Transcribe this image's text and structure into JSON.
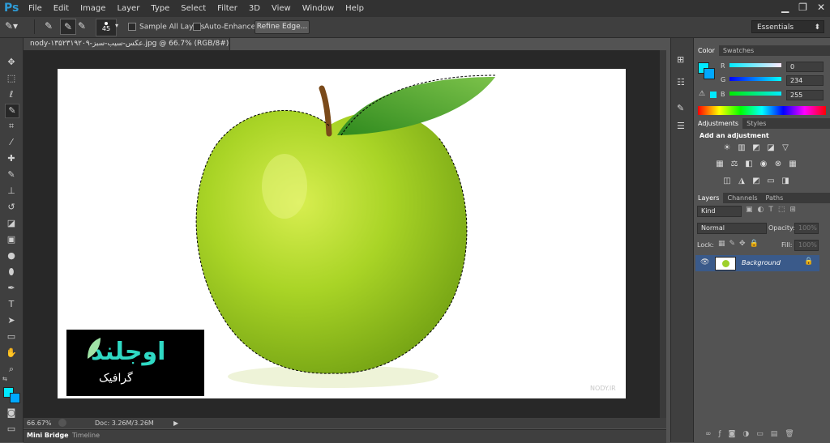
{
  "app": {
    "logo": "Ps"
  },
  "menu": [
    "File",
    "Edit",
    "Image",
    "Layer",
    "Type",
    "Select",
    "Filter",
    "3D",
    "View",
    "Window",
    "Help"
  ],
  "window_controls": [
    "minimize-icon",
    "restore-icon",
    "close-icon"
  ],
  "options": {
    "brush_size": "45",
    "sample_all_layers": "Sample All Layers",
    "auto_enhance": "Auto-Enhance",
    "refine_edge": "Refine Edge...",
    "workspace": "Essentials"
  },
  "document": {
    "tab_title": "nody-۱۳۵۲۳۱۹۲۰۹-عکس-سیب-سبز.jpg @ 66.7% (RGB/8#)",
    "tab_close": "×",
    "zoom": "66.67%",
    "doc_info": "Doc: 3.26M/3.26M",
    "watermark": "NODY.IR"
  },
  "logo_overlay": {
    "brand": "اوجلند",
    "subtitle": "گرافیک"
  },
  "bottom_tabs": [
    "Mini Bridge",
    "Timeline"
  ],
  "color_panel": {
    "tabs": [
      "Color",
      "Swatches"
    ],
    "r_label": "R",
    "g_label": "G",
    "b_label": "B",
    "r": "0",
    "g": "234",
    "b": "255",
    "foreground": "#00eaff"
  },
  "adjust_panel": {
    "tabs": [
      "Adjustments",
      "Styles"
    ],
    "heading": "Add an adjustment"
  },
  "layers_panel": {
    "tabs": [
      "Layers",
      "Channels",
      "Paths"
    ],
    "kind": "Kind",
    "blend": "Normal",
    "opacity_label": "Opacity:",
    "opacity": "100%",
    "lock_label": "Lock:",
    "fill_label": "Fill:",
    "fill": "100%",
    "layer_name": "Background"
  }
}
